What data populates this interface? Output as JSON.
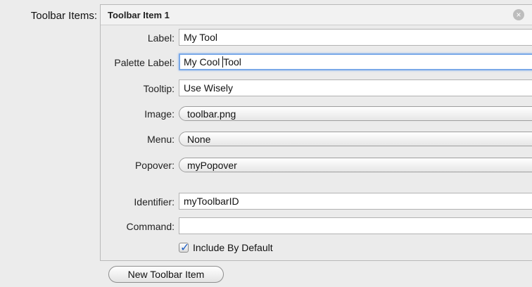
{
  "section": {
    "label": "Toolbar Items:"
  },
  "item": {
    "title": "Toolbar Item 1",
    "close_icon": "×",
    "fields": {
      "label": {
        "label": "Label:",
        "value": "My Tool"
      },
      "palette_label": {
        "label": "Palette Label:",
        "value_before_caret": "My Cool ",
        "value_after_caret": "Tool"
      },
      "tooltip": {
        "label": "Tooltip:",
        "value": "Use Wisely"
      },
      "image": {
        "label": "Image:",
        "value": "toolbar.png"
      },
      "menu": {
        "label": "Menu:",
        "value": "None"
      },
      "popover": {
        "label": "Popover:",
        "value": "myPopover"
      },
      "identifier": {
        "label": "Identifier:",
        "value": "myToolbarID"
      },
      "command": {
        "label": "Command:",
        "value": ""
      }
    },
    "include_by_default": {
      "label": "Include By Default",
      "checked": true
    }
  },
  "footer": {
    "new_item_label": "New Toolbar Item"
  },
  "colors": {
    "focus_ring": "#7aa9e8",
    "popup_arrow": "#2c6fd8",
    "check": "#1e5fc4"
  },
  "icons": {
    "close": "close-icon",
    "popup_arrows": "up-down-arrows-icon",
    "check": "checkmark-icon"
  }
}
